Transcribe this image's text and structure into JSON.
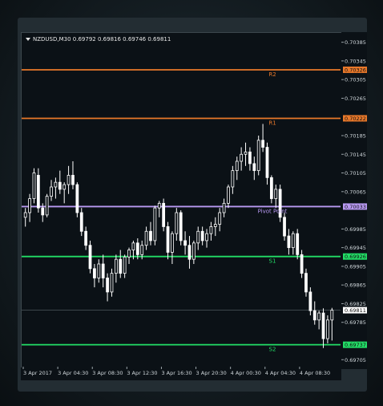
{
  "header": {
    "symbol": "NZDUSD,M30",
    "open": "0.69792",
    "high": "0.69816",
    "low": "0.69746",
    "close": "0.69811"
  },
  "price_axis": {
    "ticks": [
      "0.70385",
      "0.70345",
      "0.70305",
      "0.70265",
      "0.70185",
      "0.70145",
      "0.70105",
      "0.70065",
      "0.69985",
      "0.69945",
      "0.69905",
      "0.69865",
      "0.69825",
      "0.69785",
      "0.69705"
    ]
  },
  "time_axis": {
    "ticks": [
      "3 Apr 2017",
      "3 Apr 04:30",
      "3 Apr 08:30",
      "3 Apr 12:30",
      "3 Apr 16:30",
      "3 Apr 20:30",
      "4 Apr 00:30",
      "4 Apr 04:30",
      "4 Apr 08:30"
    ]
  },
  "levels": [
    {
      "name": "R2",
      "price": 0.70326,
      "price_label": "0.70326",
      "color": "#e8782a"
    },
    {
      "name": "R1",
      "price": 0.70222,
      "price_label": "0.70222",
      "color": "#e8782a"
    },
    {
      "name": "Pivot Point",
      "price": 0.70033,
      "price_label": "0.70033",
      "color": "#b899f2"
    },
    {
      "name": "S1",
      "price": 0.69926,
      "price_label": "0.69926",
      "color": "#22dd66"
    },
    {
      "name": "S2",
      "price": 0.69737,
      "price_label": "0.69737",
      "color": "#22dd66"
    }
  ],
  "current_price": {
    "value": 0.69811,
    "label": "0.69811",
    "color": "#ffffff"
  },
  "chart_data": {
    "type": "candlestick",
    "symbol": "NZDUSD,M30",
    "ohlc": [
      [
        0.7001,
        0.7003,
        0.6999,
        0.7002
      ],
      [
        0.7002,
        0.7006,
        0.7,
        0.7005
      ],
      [
        0.7005,
        0.70115,
        0.7004,
        0.70105
      ],
      [
        0.701,
        0.70115,
        0.7002,
        0.7003
      ],
      [
        0.7003,
        0.7004,
        0.7,
        0.70015
      ],
      [
        0.70015,
        0.7006,
        0.7001,
        0.70055
      ],
      [
        0.70055,
        0.7009,
        0.70045,
        0.70075
      ],
      [
        0.70075,
        0.70095,
        0.7005,
        0.70085
      ],
      [
        0.70085,
        0.7011,
        0.7006,
        0.7007
      ],
      [
        0.7007,
        0.70085,
        0.7004,
        0.7008
      ],
      [
        0.7008,
        0.7012,
        0.7006,
        0.701
      ],
      [
        0.701,
        0.7013,
        0.7007,
        0.7008
      ],
      [
        0.7008,
        0.70085,
        0.7001,
        0.7002
      ],
      [
        0.7002,
        0.7003,
        0.6997,
        0.6998
      ],
      [
        0.6998,
        0.6999,
        0.6994,
        0.6995
      ],
      [
        0.6995,
        0.6996,
        0.6989,
        0.699
      ],
      [
        0.699,
        0.6991,
        0.6986,
        0.6988
      ],
      [
        0.6988,
        0.6992,
        0.6987,
        0.6991
      ],
      [
        0.6991,
        0.6993,
        0.6986,
        0.6988
      ],
      [
        0.6988,
        0.6989,
        0.6983,
        0.6985
      ],
      [
        0.6985,
        0.699,
        0.6984,
        0.6989
      ],
      [
        0.6989,
        0.6993,
        0.6987,
        0.6992
      ],
      [
        0.6992,
        0.6994,
        0.6988,
        0.6989
      ],
      [
        0.6989,
        0.6993,
        0.6988,
        0.69925
      ],
      [
        0.69925,
        0.69945,
        0.6991,
        0.6994
      ],
      [
        0.6994,
        0.6996,
        0.6992,
        0.69955
      ],
      [
        0.69955,
        0.69965,
        0.6992,
        0.6993
      ],
      [
        0.6993,
        0.6996,
        0.6992,
        0.6995
      ],
      [
        0.6995,
        0.6999,
        0.6994,
        0.6998
      ],
      [
        0.6998,
        0.7,
        0.6995,
        0.6996
      ],
      [
        0.6996,
        0.70035,
        0.6995,
        0.7003
      ],
      [
        0.7003,
        0.70045,
        0.7001,
        0.7004
      ],
      [
        0.7004,
        0.7005,
        0.6998,
        0.6999
      ],
      [
        0.6999,
        0.7,
        0.6992,
        0.69935
      ],
      [
        0.69935,
        0.6998,
        0.6991,
        0.69975
      ],
      [
        0.69975,
        0.7003,
        0.6996,
        0.7002
      ],
      [
        0.7002,
        0.70025,
        0.6995,
        0.6996
      ],
      [
        0.6996,
        0.6998,
        0.6993,
        0.6995
      ],
      [
        0.6995,
        0.6997,
        0.699,
        0.6992
      ],
      [
        0.6992,
        0.6996,
        0.6991,
        0.69955
      ],
      [
        0.69955,
        0.6999,
        0.6994,
        0.6998
      ],
      [
        0.6998,
        0.6999,
        0.6995,
        0.6996
      ],
      [
        0.6996,
        0.69985,
        0.69945,
        0.69975
      ],
      [
        0.69975,
        0.7,
        0.6996,
        0.6999
      ],
      [
        0.6999,
        0.7001,
        0.6997,
        0.69995
      ],
      [
        0.69995,
        0.7003,
        0.6998,
        0.7002
      ],
      [
        0.7002,
        0.7005,
        0.7001,
        0.7004
      ],
      [
        0.7004,
        0.7008,
        0.7003,
        0.70075
      ],
      [
        0.70075,
        0.7012,
        0.7006,
        0.7011
      ],
      [
        0.7011,
        0.7014,
        0.7009,
        0.7013
      ],
      [
        0.7013,
        0.7016,
        0.7011,
        0.70145
      ],
      [
        0.70145,
        0.7017,
        0.7012,
        0.7015
      ],
      [
        0.7015,
        0.7016,
        0.7011,
        0.70125
      ],
      [
        0.70125,
        0.7014,
        0.7009,
        0.7011
      ],
      [
        0.7011,
        0.70185,
        0.701,
        0.70175
      ],
      [
        0.70175,
        0.7021,
        0.7015,
        0.7016
      ],
      [
        0.7016,
        0.7017,
        0.7008,
        0.70095
      ],
      [
        0.70095,
        0.701,
        0.7004,
        0.7005
      ],
      [
        0.7005,
        0.7008,
        0.7003,
        0.7007
      ],
      [
        0.7007,
        0.7008,
        0.7,
        0.7001
      ],
      [
        0.7001,
        0.7002,
        0.6996,
        0.6997
      ],
      [
        0.6997,
        0.69985,
        0.6993,
        0.69945
      ],
      [
        0.69945,
        0.6998,
        0.6993,
        0.69975
      ],
      [
        0.69975,
        0.69985,
        0.6992,
        0.6993
      ],
      [
        0.6993,
        0.6994,
        0.6988,
        0.6989
      ],
      [
        0.6989,
        0.699,
        0.6984,
        0.6985
      ],
      [
        0.6985,
        0.6986,
        0.698,
        0.6981
      ],
      [
        0.6981,
        0.6983,
        0.6978,
        0.6979
      ],
      [
        0.6979,
        0.6981,
        0.6977,
        0.69805
      ],
      [
        0.69805,
        0.69815,
        0.6973,
        0.6975
      ],
      [
        0.6975,
        0.698,
        0.6974,
        0.6979
      ],
      [
        0.6979,
        0.69816,
        0.69746,
        0.69811
      ]
    ],
    "horizontal_levels": [
      {
        "label": "R2",
        "value": 0.70326
      },
      {
        "label": "R1",
        "value": 0.70222
      },
      {
        "label": "Pivot Point",
        "value": 0.70033
      },
      {
        "label": "S1",
        "value": 0.69926
      },
      {
        "label": "S2",
        "value": 0.69737
      }
    ],
    "ylim": [
      0.6969,
      0.70405
    ],
    "grid": false,
    "colors": {
      "background": "#0b1116",
      "candle": "#ffffff",
      "axis_text": "#cfd6da"
    }
  }
}
